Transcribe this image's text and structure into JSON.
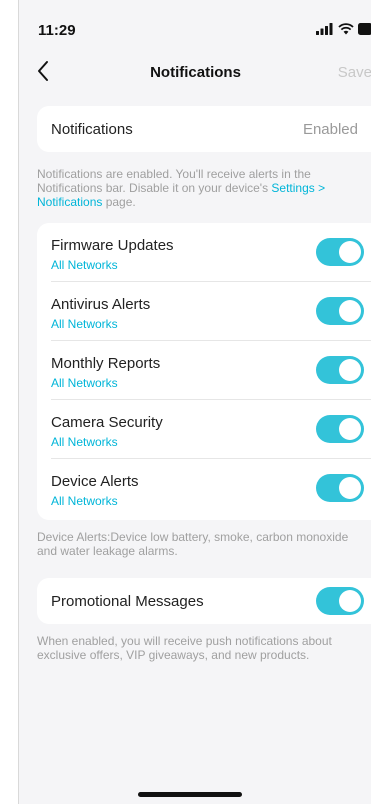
{
  "status_bar": {
    "time": "11:29",
    "signal_icon": "signal-icon",
    "wifi_icon": "wifi-icon",
    "battery_icon": "battery-icon"
  },
  "nav": {
    "title": "Notifications",
    "save_label": "Save",
    "back_icon": "chevron-left-icon"
  },
  "notifications_card": {
    "label": "Notifications",
    "value": "Enabled"
  },
  "notifications_note": {
    "text": "Notifications are enabled. You'll receive alerts in the Notifications bar. Disable it on your device's ",
    "link": "Settings > Notifications",
    "suffix": " page."
  },
  "alerts": [
    {
      "title": "Firmware Updates",
      "subtitle": "All Networks",
      "enabled": true
    },
    {
      "title": "Antivirus Alerts",
      "subtitle": "All Networks",
      "enabled": true
    },
    {
      "title": "Monthly Reports",
      "subtitle": "All Networks",
      "enabled": true
    },
    {
      "title": "Camera Security",
      "subtitle": "All Networks",
      "enabled": true
    },
    {
      "title": "Device Alerts",
      "subtitle": "All Networks",
      "enabled": true
    }
  ],
  "device_alerts_note": "Device Alerts:Device low battery, smoke, carbon monoxide and water leakage alarms.",
  "promo": {
    "title": "Promotional Messages",
    "enabled": true
  },
  "promo_note": "When enabled, you will receive push notifications about exclusive offers, VIP giveaways, and new products.",
  "colors": {
    "accent": "#33c3d9",
    "link": "#00b5d8",
    "background": "#f5f5f7"
  }
}
